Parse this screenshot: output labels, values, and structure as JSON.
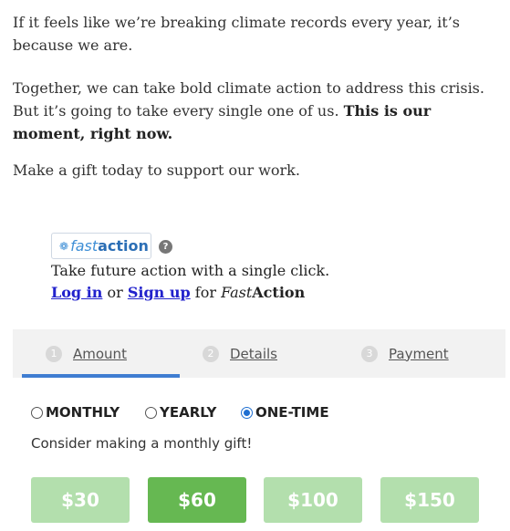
{
  "intro": {
    "p1": "If it feels like we’re breaking climate records every year, it’s because we are.",
    "p2_plain": "Together, we can take bold climate action to address this crisis. But it’s going to take every single one of us. ",
    "p2_bold": "This is our moment, right now.",
    "p3": "Make a gift today to support our work."
  },
  "fastaction": {
    "logo_fast": "fast",
    "logo_action": "action",
    "help_glyph": "?",
    "line1": "Take future action with a single click.",
    "login_link": "Log in",
    "or_text": " or ",
    "signup_link": "Sign up",
    "for_text": " for ",
    "brand_italic": "Fast",
    "brand_bold": "Action"
  },
  "steps": [
    {
      "num": "1",
      "label": "Amount"
    },
    {
      "num": "2",
      "label": "Details"
    },
    {
      "num": "3",
      "label": "Payment"
    }
  ],
  "frequency": {
    "options": [
      "MONTHLY",
      "YEARLY",
      "ONE-TIME"
    ],
    "selected": "ONE-TIME",
    "note": "Consider making a monthly gift!"
  },
  "amounts": {
    "options": [
      "$30",
      "$60",
      "$100",
      "$150"
    ],
    "selected": "$60"
  },
  "colors": {
    "accent_blue": "#3f7dd1",
    "amount_selected": "#66b852",
    "amount_unselected": "#b3dfad",
    "link": "#2222cc"
  }
}
